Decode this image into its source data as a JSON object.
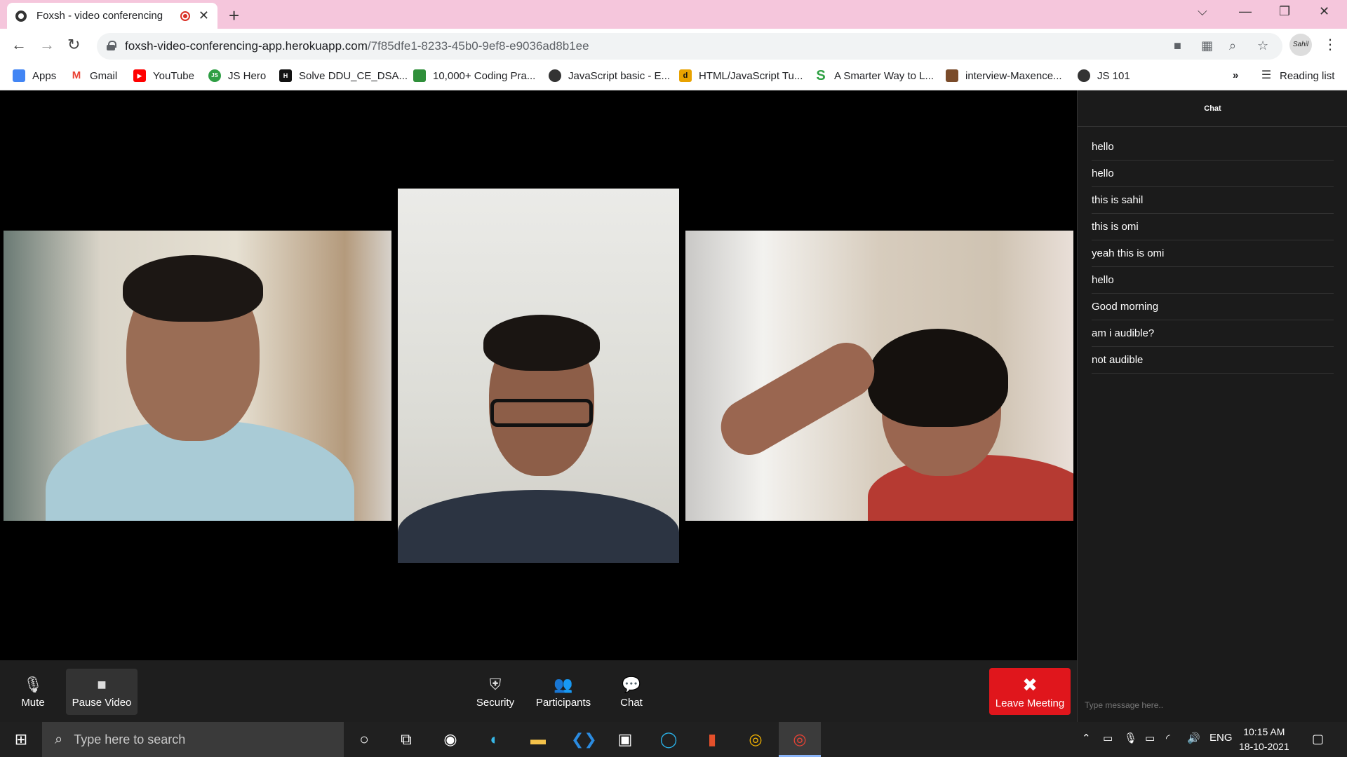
{
  "browser": {
    "tab_title": "Foxsh - video conferencing",
    "url_host": "foxsh-video-conferencing-app.herokuapp.com",
    "url_path": "/7f85dfe1-8233-45b0-9ef8-e9036ad8b1ee",
    "profile_label": "Sahil",
    "bookmarks": [
      {
        "label": "Apps",
        "icon": "apps-grid-icon",
        "color": "#4285f4"
      },
      {
        "label": "Gmail",
        "icon": "gmail-icon",
        "color": "#ea4335"
      },
      {
        "label": "YouTube",
        "icon": "youtube-icon",
        "color": "#ff0000"
      },
      {
        "label": "JS Hero",
        "icon": "jshero-icon",
        "color": "#2e9e44"
      },
      {
        "label": "Solve DDU_CE_DSA...",
        "icon": "hackerrank-icon",
        "color": "#111111"
      },
      {
        "label": "10,000+ Coding Pra...",
        "icon": "codechef-icon",
        "color": "#2f8f3a"
      },
      {
        "label": "JavaScript basic - E...",
        "icon": "globe-icon",
        "color": "#333333"
      },
      {
        "label": "HTML/JavaScript Tu...",
        "icon": "dcode-icon",
        "color": "#e8a200"
      },
      {
        "label": "A Smarter Way to L...",
        "icon": "smarter-way-icon",
        "color": "#2ea043"
      },
      {
        "label": "interview-Maxence...",
        "icon": "image-thumb-icon",
        "color": "#7a4b2a"
      },
      {
        "label": "JS 101",
        "icon": "globe-icon",
        "color": "#333333"
      }
    ],
    "overflow_label": "»",
    "reading_list": "Reading list"
  },
  "meeting": {
    "controls": {
      "mute": "Mute",
      "pause_video": "Pause Video",
      "security": "Security",
      "participants": "Participants",
      "chat": "Chat",
      "leave": "Leave Meeting"
    },
    "colors": {
      "leave": "#e0161c",
      "control_bar": "#1e1e1e",
      "chat_bg": "#1b1b1b"
    }
  },
  "chat": {
    "title": "Chat",
    "messages": [
      "hello",
      "hello",
      "this is sahil",
      "this is omi",
      "yeah this is omi",
      "hello",
      "Good morning",
      "am i audible?",
      "not audible"
    ],
    "placeholder": "Type message here.."
  },
  "taskbar": {
    "search_placeholder": "Type here to search",
    "language": "ENG",
    "time": "10:15 AM",
    "date": "18-10-2021"
  }
}
